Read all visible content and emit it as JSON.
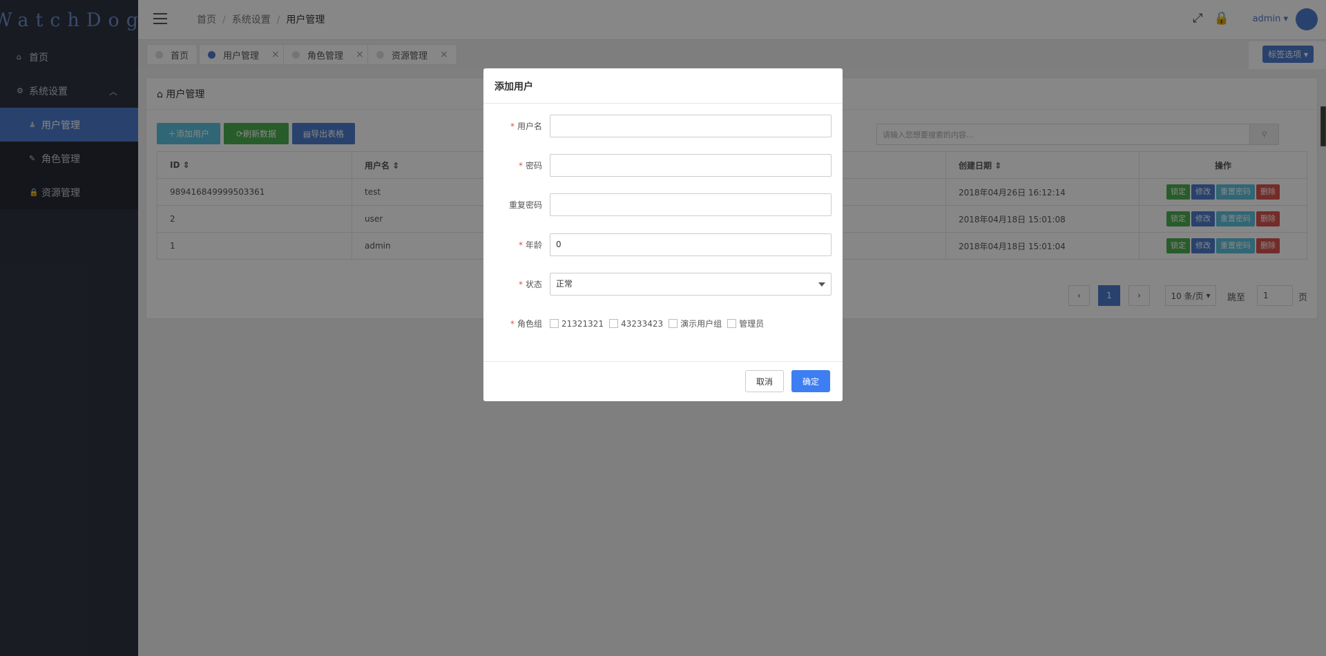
{
  "sidebar": {
    "logo": "WatchDog",
    "items": [
      {
        "label": "首页",
        "icon": "home-icon"
      },
      {
        "label": "系统设置",
        "icon": "gear-icon"
      },
      {
        "label": "用户管理",
        "icon": "user-icon"
      },
      {
        "label": "角色管理",
        "icon": "edit-icon"
      },
      {
        "label": "资源管理",
        "icon": "lock-icon"
      }
    ]
  },
  "header": {
    "breadcrumb": [
      "首页",
      "系统设置",
      "用户管理"
    ],
    "user": "admin"
  },
  "tabs": [
    {
      "label": "首页"
    },
    {
      "label": "用户管理"
    },
    {
      "label": "角色管理"
    },
    {
      "label": "资源管理"
    }
  ],
  "tab_options": "标签选项",
  "panel": {
    "title": "用户管理",
    "buttons": {
      "add": "添加用户",
      "refresh": "刷新数据",
      "export": "导出表格"
    },
    "search_placeholder": "请输入您想要搜索的内容...",
    "columns": [
      "ID",
      "用户名",
      "创建日期",
      "操作"
    ],
    "rows": [
      {
        "id": "989416849999503361",
        "username": "test",
        "created": "2018年04月26日 16:12:14"
      },
      {
        "id": "2",
        "username": "user",
        "created": "2018年04月18日 15:01:08"
      },
      {
        "id": "1",
        "username": "admin",
        "created": "2018年04月18日 15:01:04"
      }
    ],
    "row_actions": [
      "锁定",
      "修改",
      "重置密码",
      "删除"
    ],
    "pager": {
      "prev": "‹",
      "current": "1",
      "next": "›",
      "page_size": "10 条/页",
      "jump_label": "跳至",
      "jump_value": "1",
      "page_unit": "页"
    }
  },
  "modal": {
    "title": "添加用户",
    "fields": {
      "username_label": "用户名",
      "password_label": "密码",
      "repeat_label": "重复密码",
      "age_label": "年龄",
      "age_value": "0",
      "status_label": "状态",
      "status_value": "正常",
      "roles_label": "角色组"
    },
    "roles": [
      "21321321",
      "43233423",
      "演示用户组",
      "管理员"
    ],
    "cancel": "取消",
    "confirm": "确定"
  },
  "colors": {
    "primary": "#4f7ecf",
    "success": "#4caf50",
    "info": "#5bc0de",
    "danger": "#d9534f",
    "sidebar": "#2f3441"
  }
}
